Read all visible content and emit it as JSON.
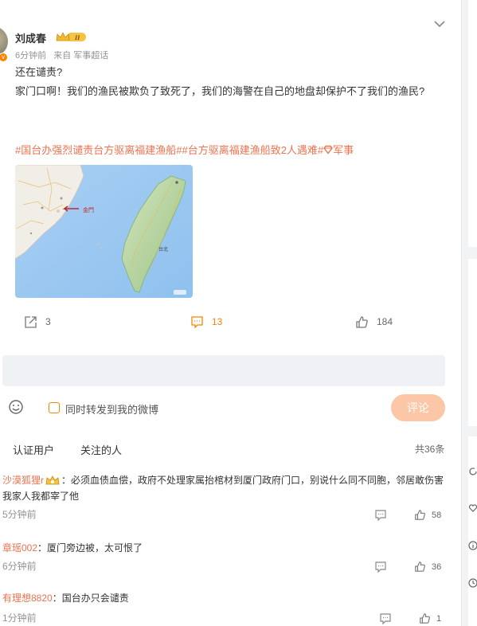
{
  "post": {
    "username": "刘成春",
    "time": "6分钟前",
    "source": "来自 军事超话",
    "text_line1": "还在谴责?",
    "text_body": "家门口啊！我们的渔民被欺负了致死了，我们的海警在自己的地盘却保护不了我们的渔民?",
    "tags": "#国台办强烈谴责台方驱离福建渔船##台方驱离福建渔船致2人遇难#",
    "topic": "军事",
    "map_label_kinmen": "金門",
    "map_label_taipei": "台北",
    "share_count": "3",
    "comment_count": "13",
    "like_count": "184"
  },
  "composer": {
    "repost_label": "同时转发到我的微博",
    "submit_label": "评论"
  },
  "tabs": {
    "verified": "认证用户",
    "following": "关注的人",
    "total": "共36条"
  },
  "comments": [
    {
      "user": "沙漠狐狸r",
      "text": "：必须血债血偿，政府不处理家属抬棺材到厦门政府门口，别说什么同不同胞，邻居敢伤害我家人我都宰了他",
      "time": "5分钟前",
      "likes": "58"
    },
    {
      "user": "章瑶002",
      "text": "：厦门旁边被，太可恨了",
      "time": "6分钟前",
      "likes": "36"
    },
    {
      "user": "有理想8820",
      "text": "：国台办只会谴责",
      "time": "1分钟前",
      "likes": "1"
    }
  ],
  "colors": {
    "accent": "#ff8200",
    "link": "#eb7350",
    "muted": "#939393"
  }
}
